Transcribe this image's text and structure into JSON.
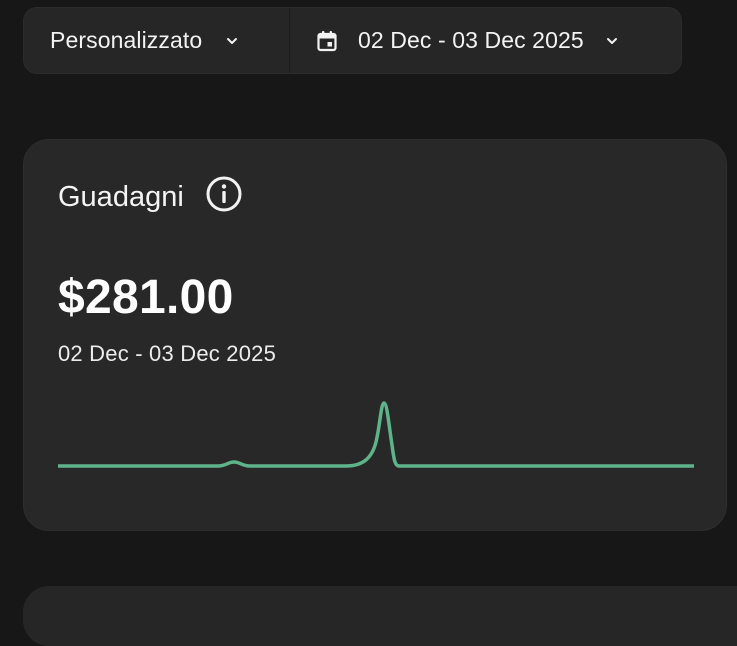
{
  "filters": {
    "period_label": "Personalizzato",
    "date_range_label": "02 Dec - 03 Dec 2025"
  },
  "earnings_card": {
    "title": "Guadagni",
    "amount": "$281.00",
    "range": "02 Dec - 03 Dec 2025",
    "sparkline": {
      "color": "#5fb38a",
      "values": [
        0,
        0,
        0,
        0,
        0,
        0.5,
        0,
        0,
        0,
        0.5,
        6,
        0,
        0,
        0,
        0,
        0,
        0,
        0,
        0,
        0
      ]
    }
  },
  "icons": {
    "chevron": "chevron-down-icon",
    "calendar": "calendar-icon",
    "info": "info-icon"
  }
}
